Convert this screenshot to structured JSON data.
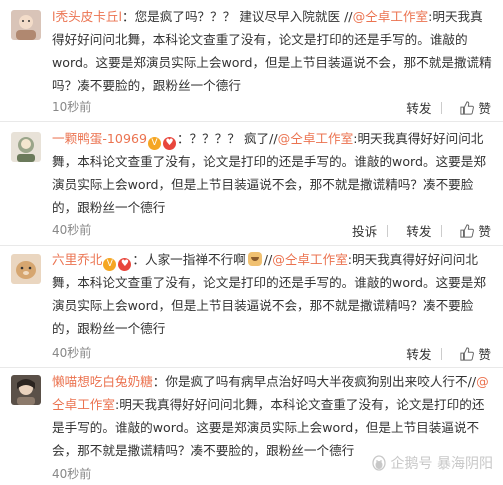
{
  "comments": [
    {
      "username": "l秃头皮卡丘l",
      "colon": "：",
      "text_before": "您是疯了吗？？？ 建议尽早入院就医 //",
      "mention": "@仝卓工作室",
      "text_after": ":明天我真得好好问问北舞，本科论文查重了没有，论文是打印的还是手写的。谁敲的word。这要是郑演员实际上会word，但是上节目装逼说不会，那不就是撒谎精吗？凑不要脸的，跟粉丝一个德行",
      "time": "10秒前",
      "actions": [
        "转发",
        "赞"
      ]
    },
    {
      "username": "一颗鸭蛋-10969",
      "colon": "：",
      "text_before": "？？？？ 疯了//",
      "mention": "@仝卓工作室",
      "text_after": ":明天我真得好好问问北舞，本科论文查重了没有，论文是打印的还是手写的。谁敲的word。这要是郑演员实际上会word，但是上节目装逼说不会，那不就是撒谎精吗？凑不要脸的，跟粉丝一个德行",
      "time": "40秒前",
      "actions": [
        "投诉",
        "转发",
        "赞"
      ]
    },
    {
      "username": "六里乔北",
      "colon": "：",
      "text_before": "人家一指禅不行啊",
      "mention": "@仝卓工作室",
      "mention_prefix": "//",
      "text_after": ":明天我真得好好问问北舞，本科论文查重了没有，论文是打印的还是手写的。谁敲的word。这要是郑演员实际上会word，但是上节目装逼说不会，那不就是撒谎精吗？凑不要脸的，跟粉丝一个德行",
      "time": "40秒前",
      "actions": [
        "转发",
        "赞"
      ]
    },
    {
      "username": "懒喵想吃白兔奶糖",
      "colon": "：",
      "text_before": "你是疯了吗有病早点治好吗大半夜疯狗别出来咬人行不//",
      "mention": "@仝卓工作室",
      "text_after": ":明天我真得好好问问北舞，本科论文查重了没有，论文是打印的还是手写的。谁敲的word。这要是郑演员实际上会word，但是上节目装逼说不会，那不就是撒谎精吗？凑不要脸的，跟粉丝一个德行",
      "time": "40秒前",
      "actions": []
    }
  ],
  "watermark": "企鹅号 暴海阴阳",
  "colors": {
    "accent": "#eb7350",
    "text": "#333333",
    "meta": "#888888"
  }
}
